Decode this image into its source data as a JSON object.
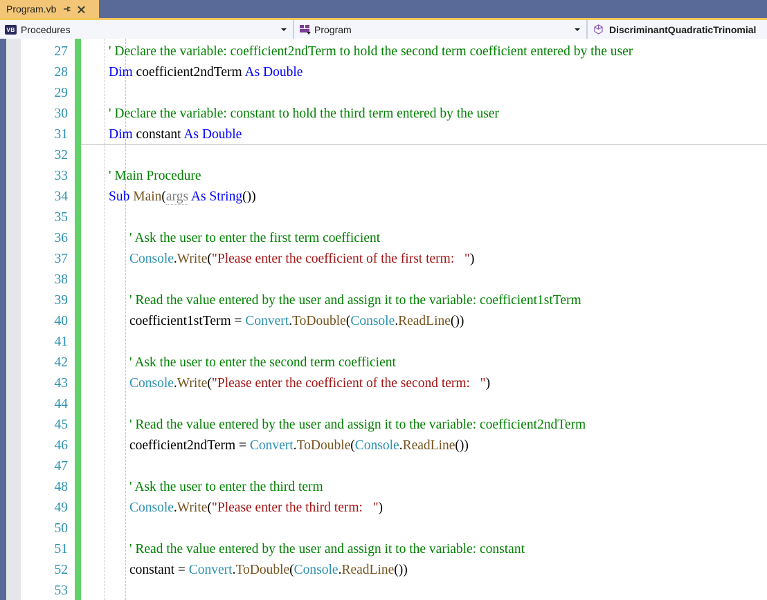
{
  "tab": {
    "title": "Program.vb",
    "pin_icon": "pin-icon",
    "close_icon": "close-icon"
  },
  "nav_bar": {
    "project_dropdown": {
      "icon": "vb-file-icon",
      "icon_text": "VB",
      "label": "Procedures"
    },
    "type_dropdown": {
      "icon": "module-icon",
      "label": "Program"
    },
    "member_dropdown": {
      "icon": "method-cube-icon",
      "label": "DiscriminantQuadraticTrinomial"
    }
  },
  "editor": {
    "language": "Visual Basic",
    "first_visible_line": 27,
    "colors": {
      "comment": "#008000",
      "keyword": "#0000ff",
      "type": "#2b91af",
      "method": "#74531f",
      "string": "#a31515",
      "line_number": "#2b91af",
      "change_bar": "#61d169",
      "tab_active_bg": "#f3c677",
      "tab_strip_bg": "#5a6a98"
    },
    "lines": [
      {
        "n": 27,
        "indent": 0,
        "tokens": [
          {
            "c": "comment",
            "t": "' Declare the variable: coefficient2ndTerm to hold the second term coefficient entered by the user"
          }
        ]
      },
      {
        "n": 28,
        "indent": 0,
        "tokens": [
          {
            "c": "keyword",
            "t": "Dim"
          },
          {
            "c": "plain",
            "t": " coefficient2ndTerm "
          },
          {
            "c": "keyword",
            "t": "As Double"
          }
        ]
      },
      {
        "n": 29,
        "indent": 0,
        "tokens": []
      },
      {
        "n": 30,
        "indent": 0,
        "tokens": [
          {
            "c": "comment",
            "t": "' Declare the variable: constant to hold the third term entered by the user"
          }
        ]
      },
      {
        "n": 31,
        "indent": 0,
        "tokens": [
          {
            "c": "keyword",
            "t": "Dim"
          },
          {
            "c": "plain",
            "t": " constant "
          },
          {
            "c": "keyword",
            "t": "As Double"
          }
        ]
      },
      {
        "n": 32,
        "indent": 0,
        "tokens": []
      },
      {
        "n": 33,
        "indent": 0,
        "tokens": [
          {
            "c": "comment",
            "t": "' Main Procedure"
          }
        ]
      },
      {
        "n": 34,
        "indent": 0,
        "tokens": [
          {
            "c": "keyword",
            "t": "Sub"
          },
          {
            "c": "plain",
            "t": " "
          },
          {
            "c": "method",
            "t": "Main"
          },
          {
            "c": "plain",
            "t": "("
          },
          {
            "c": "param",
            "t": "args"
          },
          {
            "c": "plain",
            "t": " "
          },
          {
            "c": "keyword",
            "t": "As String"
          },
          {
            "c": "plain",
            "t": "())"
          }
        ]
      },
      {
        "n": 35,
        "indent": 0,
        "tokens": []
      },
      {
        "n": 36,
        "indent": 1,
        "tokens": [
          {
            "c": "comment",
            "t": "' Ask the user to enter the first term coefficient"
          }
        ]
      },
      {
        "n": 37,
        "indent": 1,
        "tokens": [
          {
            "c": "type",
            "t": "Console"
          },
          {
            "c": "plain",
            "t": "."
          },
          {
            "c": "method",
            "t": "Write"
          },
          {
            "c": "plain",
            "t": "("
          },
          {
            "c": "string",
            "t": "\"Please enter the coefficient of the first term:   \""
          },
          {
            "c": "plain",
            "t": ")"
          }
        ]
      },
      {
        "n": 38,
        "indent": 1,
        "tokens": []
      },
      {
        "n": 39,
        "indent": 1,
        "tokens": [
          {
            "c": "comment",
            "t": "' Read the value entered by the user and assign it to the variable: coefficient1stTerm"
          }
        ]
      },
      {
        "n": 40,
        "indent": 1,
        "tokens": [
          {
            "c": "plain",
            "t": "coefficient1stTerm = "
          },
          {
            "c": "type",
            "t": "Convert"
          },
          {
            "c": "plain",
            "t": "."
          },
          {
            "c": "method",
            "t": "ToDouble"
          },
          {
            "c": "plain",
            "t": "("
          },
          {
            "c": "type",
            "t": "Console"
          },
          {
            "c": "plain",
            "t": "."
          },
          {
            "c": "method",
            "t": "ReadLine"
          },
          {
            "c": "plain",
            "t": "())"
          }
        ]
      },
      {
        "n": 41,
        "indent": 1,
        "tokens": []
      },
      {
        "n": 42,
        "indent": 1,
        "tokens": [
          {
            "c": "comment",
            "t": "' Ask the user to enter the second term coefficient"
          }
        ]
      },
      {
        "n": 43,
        "indent": 1,
        "tokens": [
          {
            "c": "type",
            "t": "Console"
          },
          {
            "c": "plain",
            "t": "."
          },
          {
            "c": "method",
            "t": "Write"
          },
          {
            "c": "plain",
            "t": "("
          },
          {
            "c": "string",
            "t": "\"Please enter the coefficient of the second term:   \""
          },
          {
            "c": "plain",
            "t": ")"
          }
        ]
      },
      {
        "n": 44,
        "indent": 1,
        "tokens": []
      },
      {
        "n": 45,
        "indent": 1,
        "tokens": [
          {
            "c": "comment",
            "t": "' Read the value entered by the user and assign it to the variable: coefficient2ndTerm"
          }
        ]
      },
      {
        "n": 46,
        "indent": 1,
        "tokens": [
          {
            "c": "plain",
            "t": "coefficient2ndTerm = "
          },
          {
            "c": "type",
            "t": "Convert"
          },
          {
            "c": "plain",
            "t": "."
          },
          {
            "c": "method",
            "t": "ToDouble"
          },
          {
            "c": "plain",
            "t": "("
          },
          {
            "c": "type",
            "t": "Console"
          },
          {
            "c": "plain",
            "t": "."
          },
          {
            "c": "method",
            "t": "ReadLine"
          },
          {
            "c": "plain",
            "t": "())"
          }
        ]
      },
      {
        "n": 47,
        "indent": 1,
        "tokens": []
      },
      {
        "n": 48,
        "indent": 1,
        "tokens": [
          {
            "c": "comment",
            "t": "' Ask the user to enter the third term"
          }
        ]
      },
      {
        "n": 49,
        "indent": 1,
        "tokens": [
          {
            "c": "type",
            "t": "Console"
          },
          {
            "c": "plain",
            "t": "."
          },
          {
            "c": "method",
            "t": "Write"
          },
          {
            "c": "plain",
            "t": "("
          },
          {
            "c": "string",
            "t": "\"Please enter the third term:   \""
          },
          {
            "c": "plain",
            "t": ")"
          }
        ]
      },
      {
        "n": 50,
        "indent": 1,
        "tokens": []
      },
      {
        "n": 51,
        "indent": 1,
        "tokens": [
          {
            "c": "comment",
            "t": "' Read the value entered by the user and assign it to the variable: constant"
          }
        ]
      },
      {
        "n": 52,
        "indent": 1,
        "tokens": [
          {
            "c": "plain",
            "t": "constant = "
          },
          {
            "c": "type",
            "t": "Convert"
          },
          {
            "c": "plain",
            "t": "."
          },
          {
            "c": "method",
            "t": "ToDouble"
          },
          {
            "c": "plain",
            "t": "("
          },
          {
            "c": "type",
            "t": "Console"
          },
          {
            "c": "plain",
            "t": "."
          },
          {
            "c": "method",
            "t": "ReadLine"
          },
          {
            "c": "plain",
            "t": "())"
          }
        ]
      },
      {
        "n": 53,
        "indent": 1,
        "tokens": []
      }
    ],
    "outline_markers": [
      {
        "line": 34,
        "state": "expanded"
      }
    ],
    "region_separators": [
      {
        "after_line": 31
      }
    ]
  }
}
